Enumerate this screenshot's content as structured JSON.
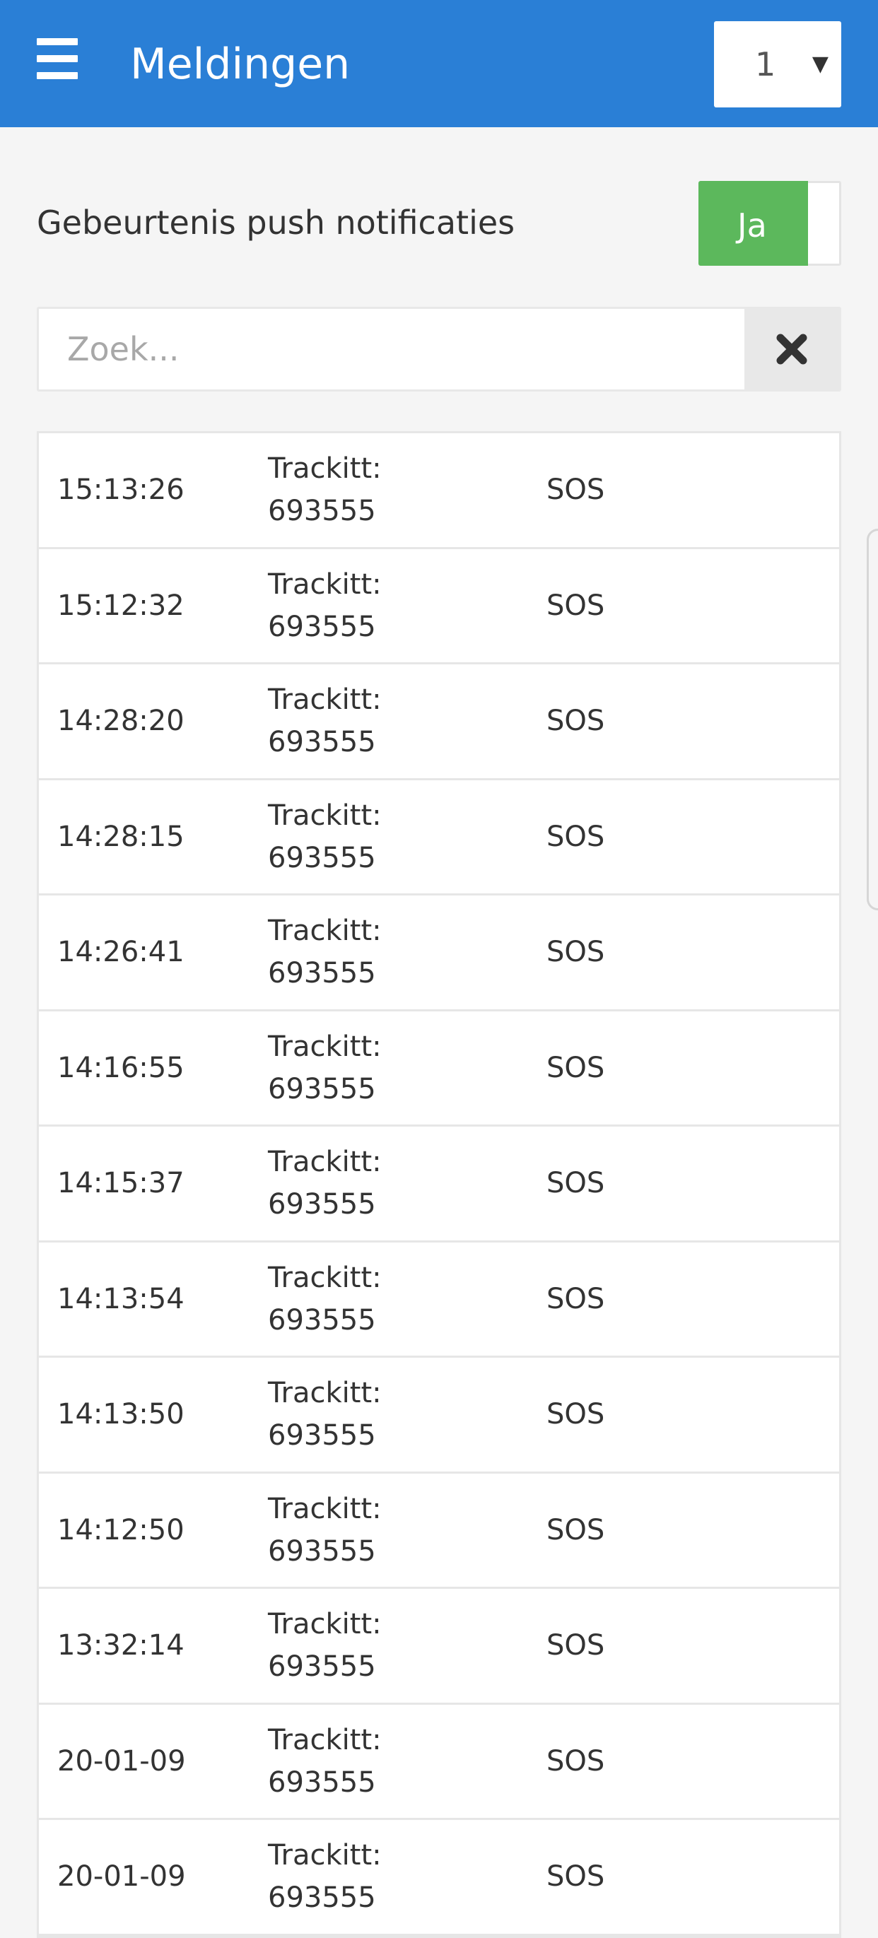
{
  "header": {
    "title": "Meldingen",
    "page_select_value": "1",
    "dropdown_arrow": "▼"
  },
  "push": {
    "label": "Gebeurtenis push notificaties",
    "toggle_label": "Ja",
    "enabled": true
  },
  "search": {
    "placeholder": "Zoek...",
    "value": ""
  },
  "events": [
    {
      "time": "15:13:26",
      "device_line1": "Trackitt:",
      "device_line2": "693555",
      "event": "SOS"
    },
    {
      "time": "15:12:32",
      "device_line1": "Trackitt:",
      "device_line2": "693555",
      "event": "SOS"
    },
    {
      "time": "14:28:20",
      "device_line1": "Trackitt:",
      "device_line2": "693555",
      "event": "SOS"
    },
    {
      "time": "14:28:15",
      "device_line1": "Trackitt:",
      "device_line2": "693555",
      "event": "SOS"
    },
    {
      "time": "14:26:41",
      "device_line1": "Trackitt:",
      "device_line2": "693555",
      "event": "SOS"
    },
    {
      "time": "14:16:55",
      "device_line1": "Trackitt:",
      "device_line2": "693555",
      "event": "SOS"
    },
    {
      "time": "14:15:37",
      "device_line1": "Trackitt:",
      "device_line2": "693555",
      "event": "SOS"
    },
    {
      "time": "14:13:54",
      "device_line1": "Trackitt:",
      "device_line2": "693555",
      "event": "SOS"
    },
    {
      "time": "14:13:50",
      "device_line1": "Trackitt:",
      "device_line2": "693555",
      "event": "SOS"
    },
    {
      "time": "14:12:50",
      "device_line1": "Trackitt:",
      "device_line2": "693555",
      "event": "SOS"
    },
    {
      "time": "13:32:14",
      "device_line1": "Trackitt:",
      "device_line2": "693555",
      "event": "SOS"
    },
    {
      "time": "20-01-09",
      "device_line1": "Trackitt:",
      "device_line2": "693555",
      "event": "SOS"
    },
    {
      "time": "20-01-09",
      "device_line1": "Trackitt:",
      "device_line2": "693555",
      "event": "SOS"
    }
  ],
  "colors": {
    "header_bg": "#2a7fd6",
    "toggle_on": "#5cb85c",
    "page_bg": "#f5f5f5"
  },
  "icons": {
    "menu": "hamburger-menu-icon",
    "clear": "close-icon",
    "dropdown": "chevron-down-icon"
  }
}
